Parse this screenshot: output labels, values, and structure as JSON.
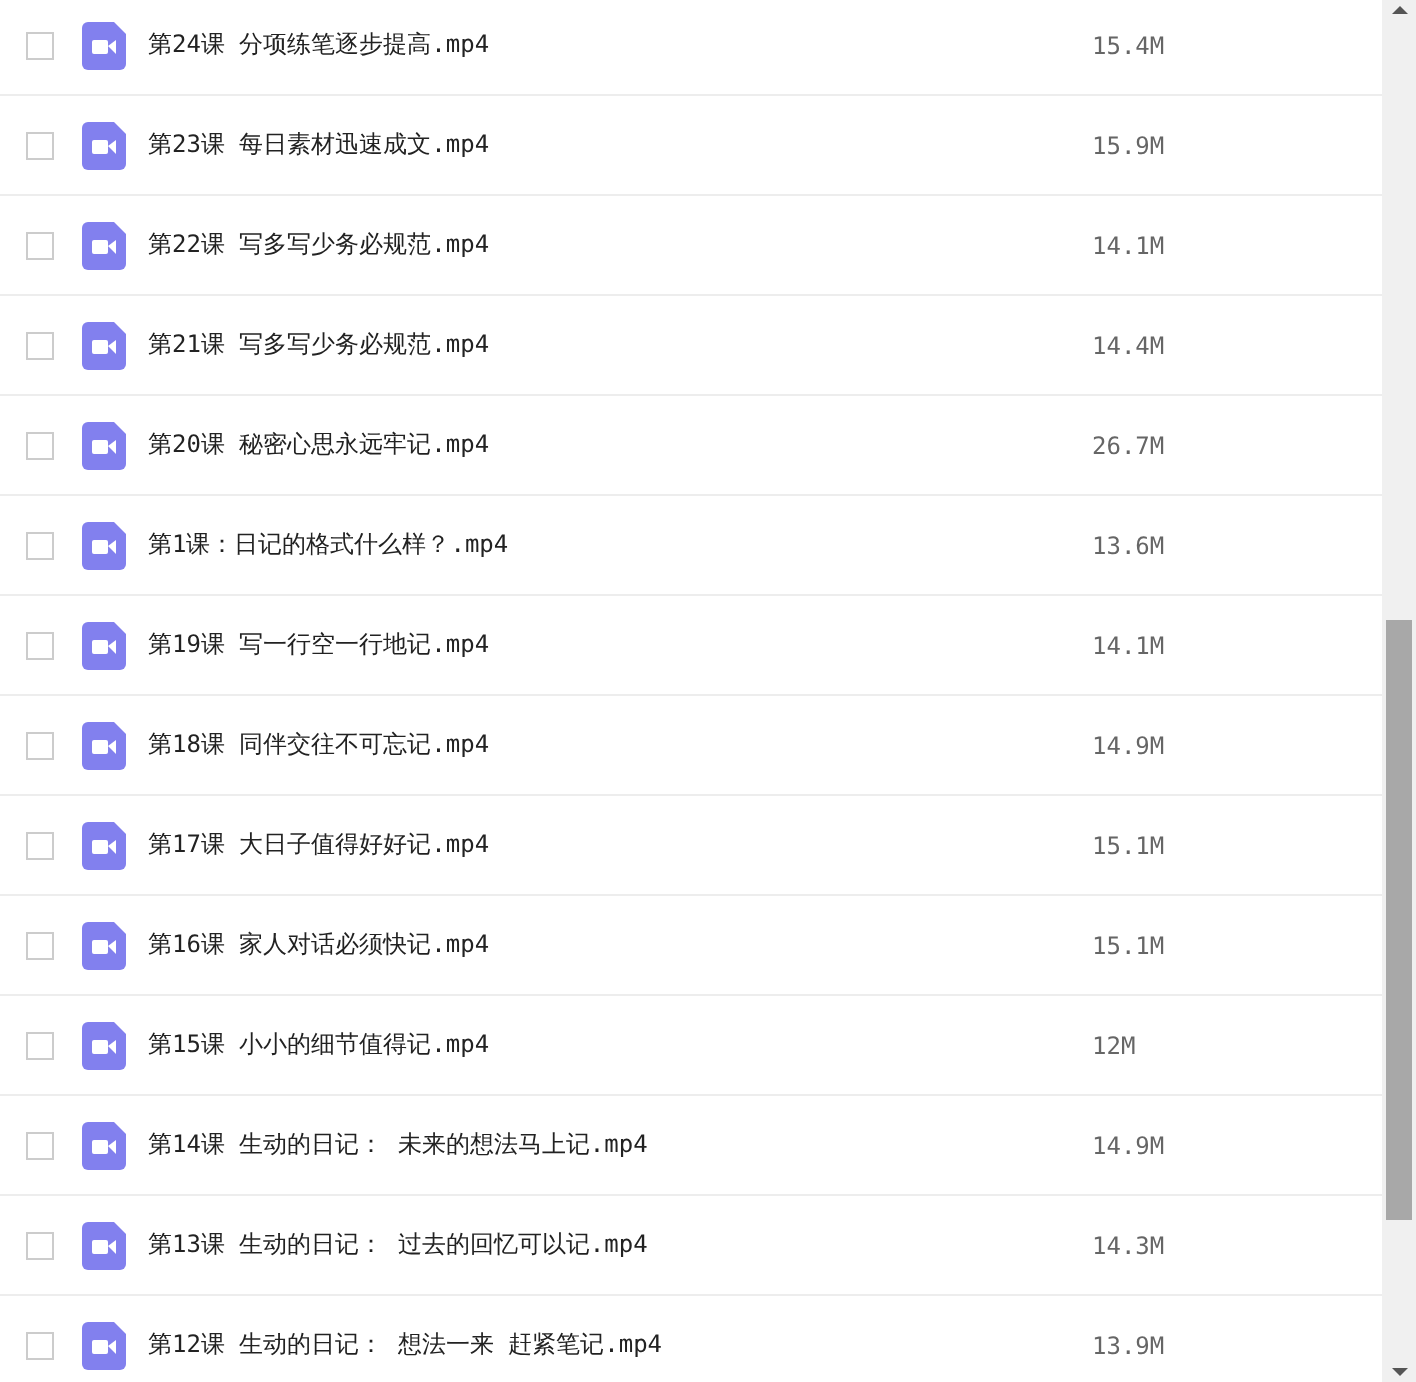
{
  "files": [
    {
      "name": "第24课 分项练笔逐步提高.mp4",
      "size": "15.4M",
      "checked": false
    },
    {
      "name": "第23课 每日素材迅速成文.mp4",
      "size": "15.9M",
      "checked": false
    },
    {
      "name": "第22课 写多写少务必规范.mp4",
      "size": "14.1M",
      "checked": false
    },
    {
      "name": "第21课 写多写少务必规范.mp4",
      "size": "14.4M",
      "checked": false
    },
    {
      "name": "第20课 秘密心思永远牢记.mp4",
      "size": "26.7M",
      "checked": false
    },
    {
      "name": "第1课：日记的格式什么样？.mp4",
      "size": "13.6M",
      "checked": false
    },
    {
      "name": "第19课 写一行空一行地记.mp4",
      "size": "14.1M",
      "checked": false
    },
    {
      "name": "第18课 同伴交往不可忘记.mp4",
      "size": "14.9M",
      "checked": false
    },
    {
      "name": "第17课 大日子值得好好记.mp4",
      "size": "15.1M",
      "checked": false
    },
    {
      "name": "第16课 家人对话必须快记.mp4",
      "size": "15.1M",
      "checked": false
    },
    {
      "name": "第15课 小小的细节值得记.mp4",
      "size": "12M",
      "checked": false
    },
    {
      "name": "第14课 生动的日记： 未来的想法马上记.mp4",
      "size": "14.9M",
      "checked": false
    },
    {
      "name": "第13课 生动的日记： 过去的回忆可以记.mp4",
      "size": "14.3M",
      "checked": false
    },
    {
      "name": "第12课 生动的日记： 想法一来 赶紧笔记.mp4",
      "size": "13.9M",
      "checked": false
    }
  ]
}
